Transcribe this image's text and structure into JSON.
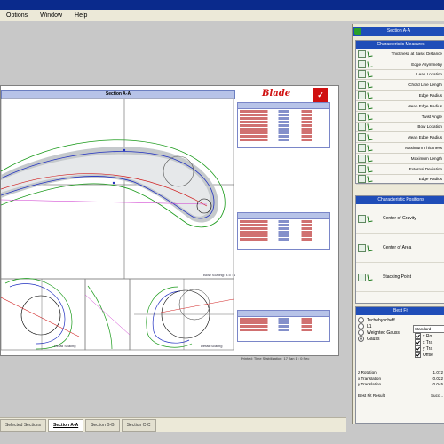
{
  "menu": [
    "Options",
    "Window",
    "Help"
  ],
  "document": {
    "plot_title": "Section A-A",
    "logo_text": "Blade",
    "scale_main": "Blow Scaling: 8.5 : 1",
    "scale_detail_1": "Detail Scaling",
    "scale_detail_2": "Detail Scaling",
    "footer": "Printed: Time Stabilization: 17 Jan 1 : 0:Sec"
  },
  "tabs": [
    "Selected Sections",
    "Section A-A",
    "Section B-B",
    "Section C-C"
  ],
  "right_panel": {
    "title": "Section A-A",
    "measures_caption": "Characteristic Measures",
    "measures": [
      "Thickness at Basic Distance",
      "Edge Asymmetry",
      "Lean Location",
      "Chord Line Length",
      "Edge Radius",
      "Mean Edge Radius",
      "Twist Angle",
      "Bow Location",
      "Mean Edge Radius",
      "Maximum Thickness",
      "Maximum Length",
      "External Deviation",
      "Edge Radius"
    ],
    "positions_caption": "Characteristic Positions",
    "positions": [
      "Center of Gravity",
      "Center of Area",
      "Stacking Point"
    ],
    "bestfit_caption": "Best Fit",
    "bestfit_options": [
      "Tschebyscheff",
      "L1",
      "Weighted Gauss",
      "Gauss"
    ],
    "bestfit_select": "Standard",
    "bestfit_checks": [
      "x Ro",
      "x Tra",
      "y Tra",
      "Offse"
    ],
    "results": [
      {
        "label": "z Rotation",
        "value": "1.072"
      },
      {
        "label": "x Translation",
        "value": "0.022"
      },
      {
        "label": "y Translation",
        "value": "0.045"
      }
    ],
    "result_footer": {
      "label": "Best Fit Result",
      "value": "Succ..."
    }
  },
  "colors": {
    "titlebar": "#0a2a8c",
    "panel_header": "#1f4db8",
    "plot_header": "#b7c3e8"
  }
}
